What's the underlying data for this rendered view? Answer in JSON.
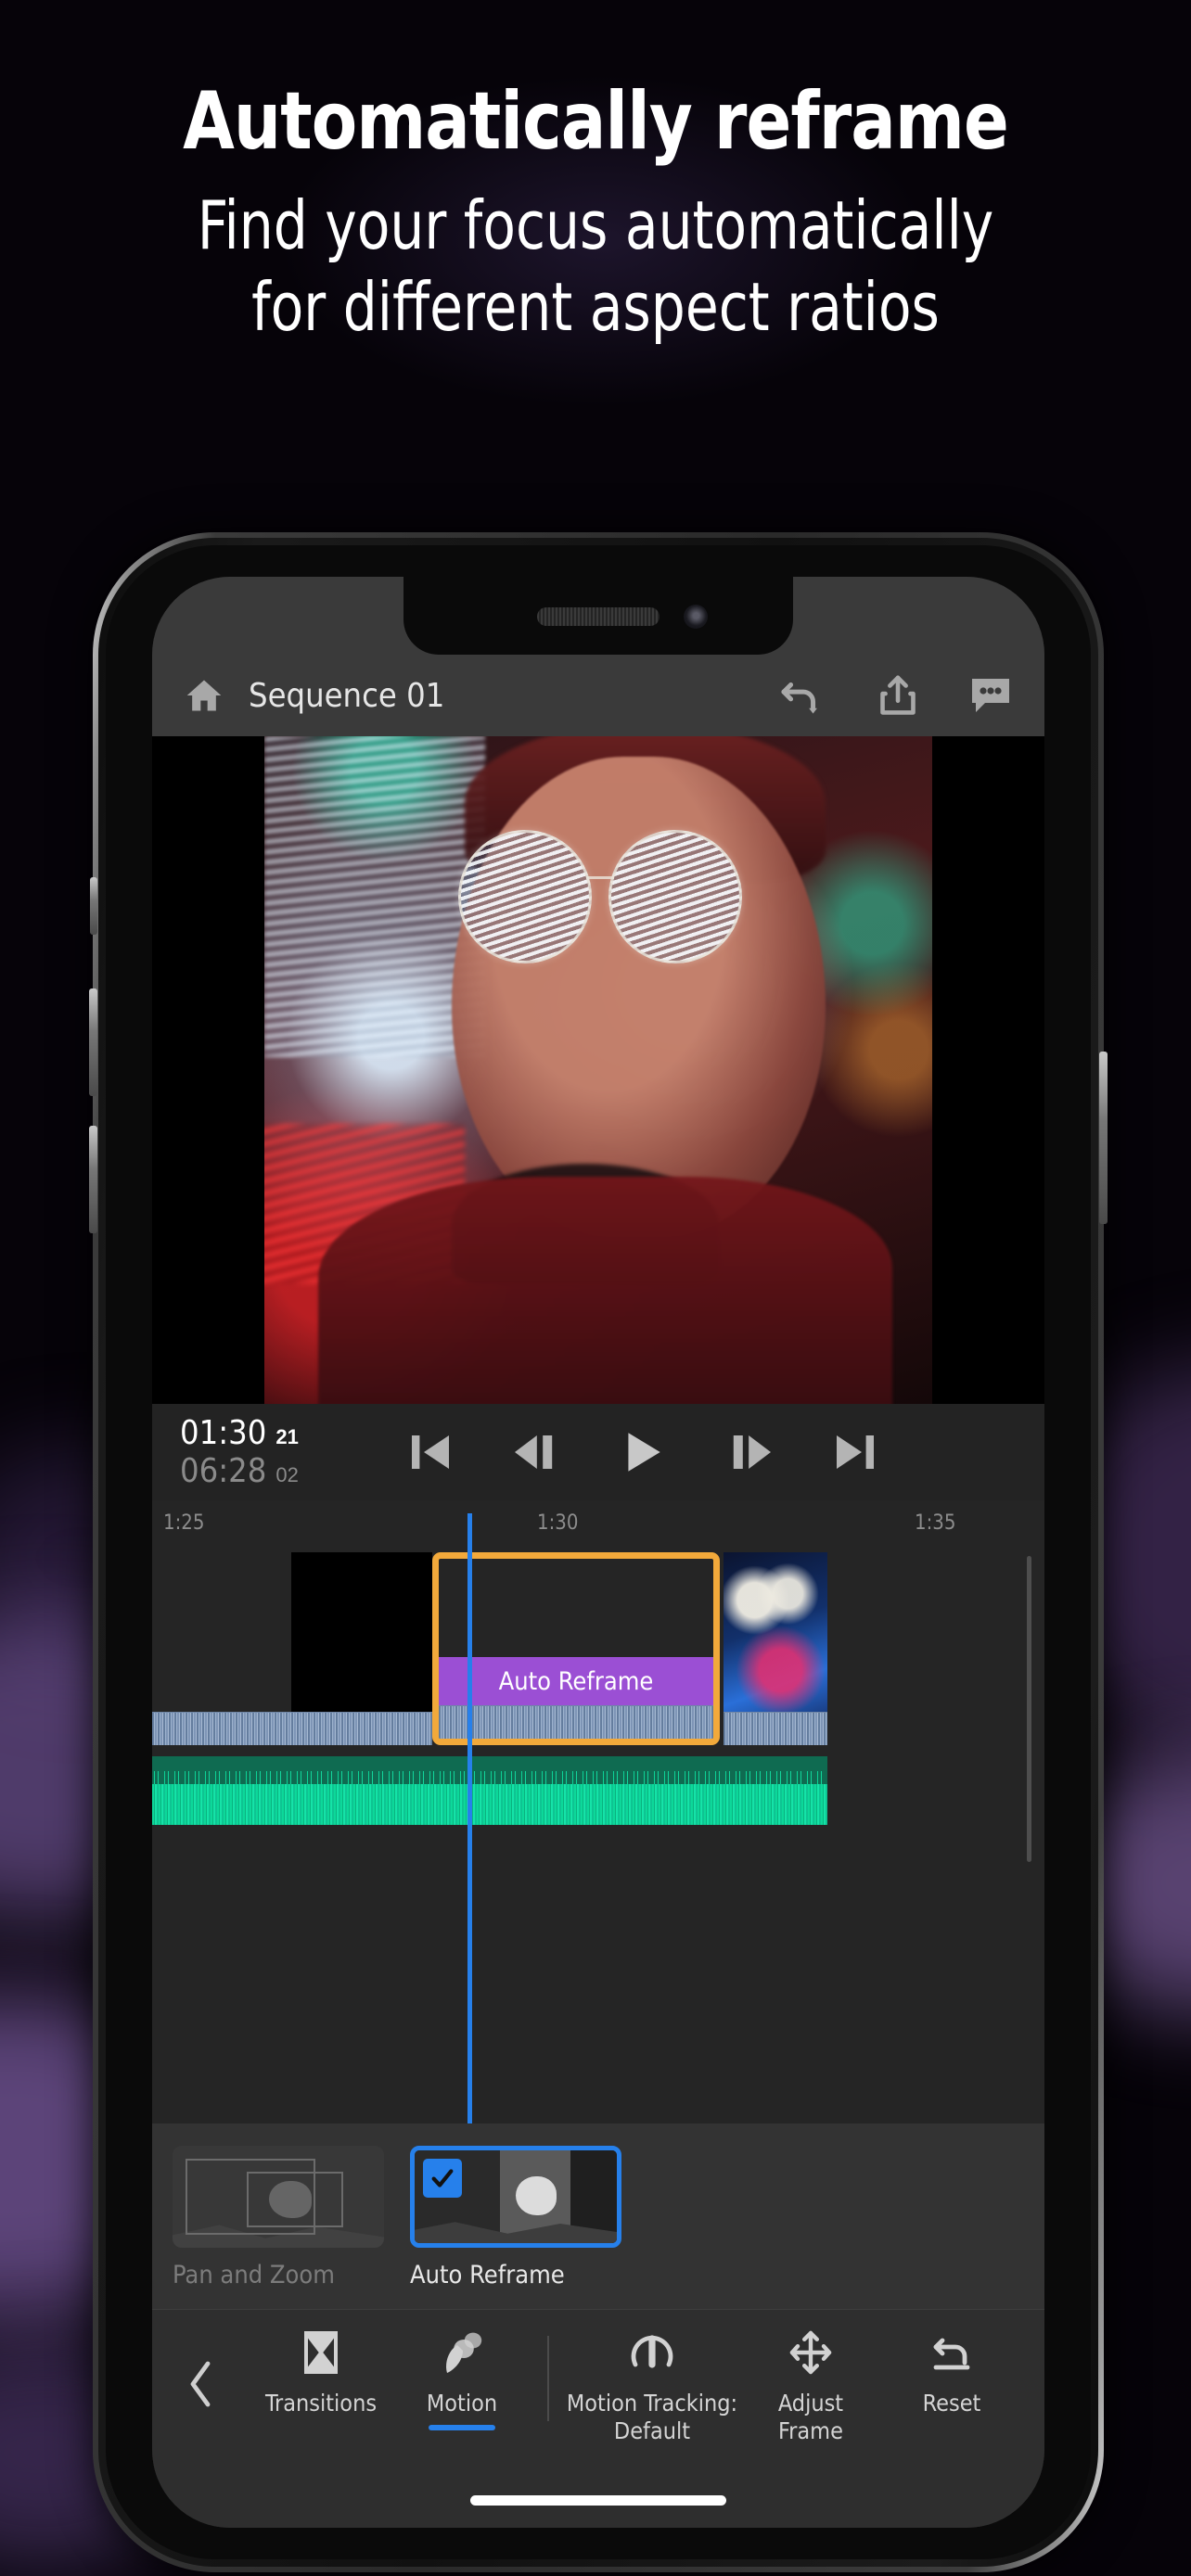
{
  "promo": {
    "title": "Automatically reframe",
    "subtitle_line1": "Find your focus automatically",
    "subtitle_line2": "for different aspect ratios"
  },
  "colors": {
    "accent_blue": "#2680eb",
    "selection_orange": "#f2a93b",
    "effect_purple": "#9b4fd4",
    "audio_green": "#0dd89a",
    "app_bg": "#1e1e1e",
    "topbar_bg": "#3a3a3a"
  },
  "app": {
    "topbar": {
      "home_icon": "home-icon",
      "title": "Sequence 01",
      "undo_icon": "undo-dropdown-icon",
      "share_icon": "share-export-icon",
      "comments_icon": "comments-icon"
    },
    "transport": {
      "current_time": "01:30",
      "current_frames": "21",
      "duration_time": "06:28",
      "duration_frames": "02",
      "buttons": [
        {
          "name": "skip-to-start-button",
          "icon": "skip-previous-icon"
        },
        {
          "name": "step-back-button",
          "icon": "step-backward-icon"
        },
        {
          "name": "play-button",
          "icon": "play-icon"
        },
        {
          "name": "step-forward-button",
          "icon": "step-forward-icon"
        },
        {
          "name": "skip-to-end-button",
          "icon": "skip-next-icon"
        }
      ]
    },
    "timeline": {
      "ruler_ticks": [
        "1:25",
        "1:30",
        "1:35"
      ],
      "playhead_label": "playhead",
      "clips": [
        {
          "name": "clip-city-skyline",
          "selected": false,
          "label": ""
        },
        {
          "name": "clip-black",
          "selected": false,
          "label": ""
        },
        {
          "name": "clip-auto-reframe",
          "selected": true,
          "label": "Auto Reframe"
        },
        {
          "name": "clip-lanterns",
          "selected": false,
          "label": ""
        }
      ],
      "audio_track": {
        "name": "audio-track",
        "label": ""
      }
    },
    "effects_panel": {
      "items": [
        {
          "name": "effect-pan-and-zoom",
          "label": "Pan and Zoom",
          "selected": false,
          "checked": false
        },
        {
          "name": "effect-auto-reframe",
          "label": "Auto Reframe",
          "selected": true,
          "checked": true
        }
      ]
    },
    "bottom_toolbar": {
      "back_icon": "chevron-left-icon",
      "items": [
        {
          "name": "tab-transitions",
          "label": "Transitions",
          "icon": "transitions-icon",
          "active": false
        },
        {
          "name": "tab-motion",
          "label": "Motion",
          "icon": "motion-icon",
          "active": true
        },
        {
          "name": "tool-motion-tracking",
          "label_line1": "Motion Tracking:",
          "label_line2": "Default",
          "icon": "motion-tracking-gauge-icon",
          "active": false
        },
        {
          "name": "tool-adjust-frame",
          "label_line1": "Adjust",
          "label_line2": "Frame",
          "icon": "move-arrows-icon",
          "active": false
        },
        {
          "name": "tool-reset",
          "label": "Reset",
          "icon": "reset-undo-icon",
          "active": false
        }
      ]
    },
    "home_indicator": "home-indicator"
  }
}
